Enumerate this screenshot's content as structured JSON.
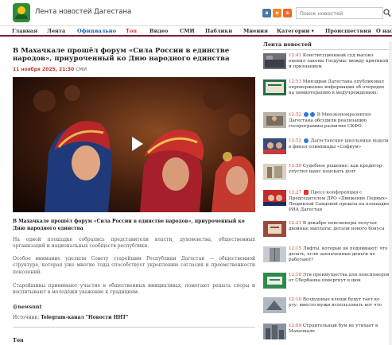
{
  "header": {
    "site_title": "Лента новостей Дагестана",
    "social": [
      "vk",
      "ok",
      "rss"
    ],
    "search_placeholder": "Поиск новостей"
  },
  "nav": [
    {
      "label": "Главная",
      "active": false
    },
    {
      "label": "Лента",
      "active": false
    },
    {
      "label": "Официально",
      "active": "blue"
    },
    {
      "label": "Топ",
      "active": "red"
    },
    {
      "label": "Видео",
      "active": false
    },
    {
      "label": "СМИ",
      "active": false
    },
    {
      "label": "Паблики",
      "active": false
    },
    {
      "label": "Мнения",
      "active": false
    },
    {
      "label": "Категории ▾",
      "active": false
    },
    {
      "label": "Происшествия",
      "active": false
    },
    {
      "label": "О нас",
      "active": false
    }
  ],
  "article": {
    "title": "В Махачкале прошёл форум «Сила России в единстве народов», приуроченный ко Дню народного единства",
    "date": "11 ноября 2025, 21:30",
    "source_tag": "СМИ",
    "caption": "В Махачкале прошёл форум «Сила России в единстве народов», приуроченный ко Дню народного единства",
    "paragraphs": [
      "На одной площадке собрались представители власти, духовенства, общественных организаций и национальных сообществ республики.",
      "Особое внимание уделили Совету старейшин Республики Дагестан — общественной структуре, которая уже многие годы способствует укреплению согласия и преемственности поколений.",
      "Старейшины принимают участие в общественных инициативах, помогают решать споры и воспитывают в молодёжи уважение к традициям."
    ],
    "hashtag": "@newsnnt",
    "source_label": "Источник:",
    "source_value": "Telegram-канал \"Новости ННТ\"",
    "top_heading": "Топ"
  },
  "sidebar": {
    "heading": "Лента новостей",
    "items": [
      {
        "time": "12:41",
        "text": "Конституционный суд высоко оценил законы Госдумы: между критикой и признанием",
        "badges": []
      },
      {
        "time": "12:53",
        "text": "Минздрав Дагестана опубликовал опровержение информации об очередях на химиотерапию в медучреждениях:",
        "badges": []
      },
      {
        "time": "12:52",
        "text": "В Минэкономразвития Дагестана обсудили реализацию госпрограммы развития СКФО",
        "badges": [
          "blue",
          "blue"
        ]
      },
      {
        "time": "12:52",
        "text": "Дагестанские школьники вышли в финал олимпиады «Софиум»",
        "badges": [
          "blue"
        ]
      },
      {
        "time": "12:50",
        "text": "Судебное решение: как кредитор упустил шанс взыскать долг",
        "badges": []
      },
      {
        "time": "12:27",
        "text": "Пресс-конференция с Председателем ДРО «Движение Первых» Людмилой Сандовой прошла на площадке РИА Дагестан",
        "badges": [
          "red"
        ]
      },
      {
        "time": "12:21",
        "text": "В декабре пенсионеры получат двойные выплаты: детали нового бонуса",
        "badges": []
      },
      {
        "time": "12:15",
        "text": "Лифты, которые не поднимают: что делать, если заплаченные деньги не работают?",
        "badges": []
      },
      {
        "time": "12:10",
        "text": "Эти преимущества для пенсионеров от Сбербанка повергнут в шок",
        "badges": []
      },
      {
        "time": "12:10",
        "text": "Воздушные клещи будут тает ко рту: вместо мужи использовать вот что",
        "badges": []
      },
      {
        "time": "12:09",
        "text": "Строительный бум не утихает в Махачкале",
        "badges": []
      }
    ]
  },
  "colors": {
    "accent": "#7a2230",
    "date_red": "#c0392b",
    "nav_blue": "#1a5fb4",
    "nav_red": "#d0312d"
  }
}
